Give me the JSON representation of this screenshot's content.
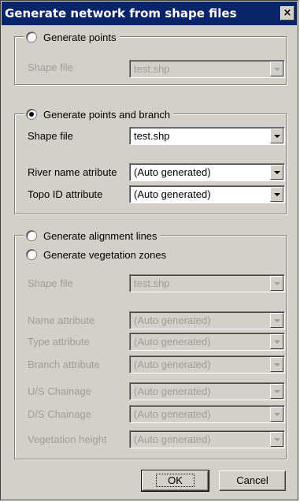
{
  "window": {
    "title": "Generate network from shape files",
    "close_label": "×"
  },
  "group_points": {
    "radio_label": "Generate points",
    "selected": false,
    "shape_file_label": "Shape file",
    "shape_file_value": "test.shp"
  },
  "group_points_branch": {
    "radio_label": "Generate points and branch",
    "selected": true,
    "shape_file_label": "Shape file",
    "shape_file_value": "test.shp",
    "river_name_label": "River name atribute",
    "river_name_value": "(Auto generated)",
    "topo_id_label": "Topo ID attribute",
    "topo_id_value": "(Auto generated)"
  },
  "group_alignment": {
    "radio_alignment_label": "Generate alignment lines",
    "radio_vegetation_label": "Generate vegetation zones",
    "shape_file_label": "Shape file",
    "shape_file_value": "test.shp",
    "fields": [
      {
        "label": "Name attribute",
        "value": "(Auto generated)"
      },
      {
        "label": "Type attribute",
        "value": "(Auto generated)"
      },
      {
        "label": "Branch attribute",
        "value": "(Auto generated)"
      },
      {
        "label": "U/S Chainage",
        "value": "(Auto generated)"
      },
      {
        "label": "D/S Chainage",
        "value": "(Auto generated)"
      },
      {
        "label": "Vegetation height",
        "value": "(Auto generated)"
      }
    ]
  },
  "buttons": {
    "ok_label": "OK",
    "cancel_label": "Cancel"
  },
  "colors": {
    "titlebar": "#0a246a",
    "dialog_face": "#d4d0c8",
    "disabled_text": "#9d9d9d"
  }
}
